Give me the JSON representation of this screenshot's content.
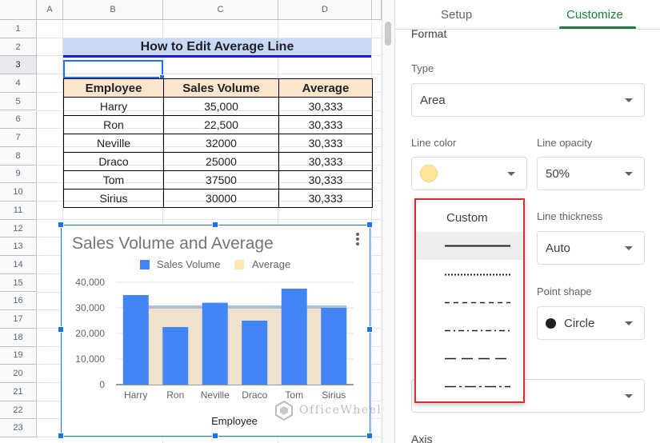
{
  "sheet": {
    "columns": [
      "A",
      "B",
      "C",
      "D"
    ],
    "rows": [
      "1",
      "2",
      "3",
      "4",
      "5",
      "6",
      "7",
      "8",
      "9",
      "10",
      "11",
      "12",
      "13",
      "14",
      "15",
      "16",
      "17",
      "18",
      "19",
      "20",
      "21",
      "22",
      "23"
    ],
    "title": "How to Edit Average Line",
    "headers": [
      "Employee",
      "Sales Volume",
      "Average"
    ],
    "data_rows": [
      [
        "Harry",
        "35,000",
        "30,333"
      ],
      [
        "Ron",
        "22,500",
        "30,333"
      ],
      [
        "Neville",
        "32000",
        "30,333"
      ],
      [
        "Draco",
        "25000",
        "30,333"
      ],
      [
        "Tom",
        "37500",
        "30,333"
      ],
      [
        "Sirius",
        "30000",
        "30,333"
      ]
    ]
  },
  "chart_data": {
    "type": "bar",
    "title": "Sales Volume and Average",
    "xlabel": "Employee",
    "ylabel": "",
    "categories": [
      "Harry",
      "Ron",
      "Neville",
      "Draco",
      "Tom",
      "Sirius"
    ],
    "series": [
      {
        "name": "Sales Volume",
        "type": "bar",
        "values": [
          35000,
          22500,
          32000,
          25000,
          37500,
          30000
        ],
        "color": "#4285f4"
      },
      {
        "name": "Average",
        "type": "area",
        "values": [
          30333,
          30333,
          30333,
          30333,
          30333,
          30333
        ],
        "color": "#fce8b2"
      }
    ],
    "yticks": [
      "0",
      "10,000",
      "20,000",
      "30,000",
      "40,000"
    ],
    "ylim": [
      0,
      40000
    ],
    "legend": "top",
    "grid": true
  },
  "watermark": "OfficeWheel",
  "panel": {
    "tabs": [
      "Setup",
      "Customize"
    ],
    "active_tab": "Customize",
    "section_title": "Format",
    "type_label": "Type",
    "type_value": "Area",
    "line_color_label": "Line color",
    "line_color": "#ffe599",
    "line_opacity_label": "Line opacity",
    "line_opacity_value": "50%",
    "line_thickness_label": "Line thickness",
    "line_thickness_value": "Auto",
    "point_shape_label": "Point shape",
    "point_shape_value": "Circle",
    "axis_label": "Axis",
    "accent": "#188038",
    "dash_menu": {
      "header": "Custom",
      "options": [
        "solid",
        "dotted",
        "dashed",
        "dash-dot",
        "long-dash",
        "long-dash-dot"
      ],
      "selected": "solid"
    }
  }
}
